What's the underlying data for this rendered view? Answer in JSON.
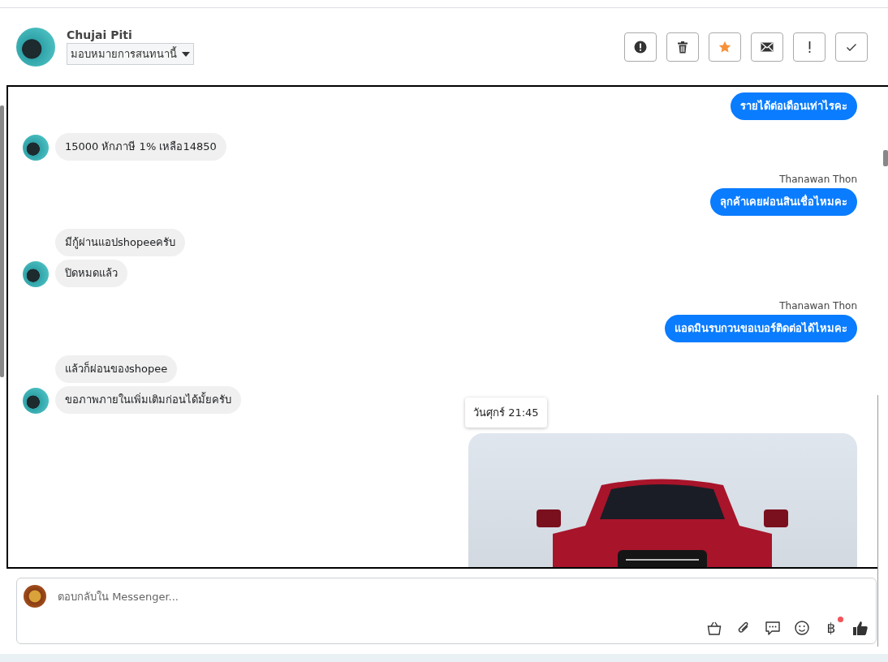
{
  "header": {
    "name": "Chujai Piti",
    "assign": "มอบหมายการสนทนานี้",
    "starred": true
  },
  "messages": [
    {
      "outgoing": true,
      "text": "รายได้ต่อเดือนเท่าไรคะ"
    },
    {
      "outgoing": false,
      "avatar": true,
      "text": "15000 หักภาษี 1% เหลือ14850"
    },
    {
      "outgoing": true,
      "sender": "Thanawan Thon",
      "text": "ลุกค้าเคยผ่อนสินเชื่อไหมคะ"
    },
    {
      "outgoing": false,
      "avatar": false,
      "text": "มีกู้ผ่านแอปshopeeครับ"
    },
    {
      "outgoing": false,
      "avatar": true,
      "text": "ปิดหมดแล้ว"
    },
    {
      "outgoing": true,
      "sender": "Thanawan Thon",
      "text": "แอดมินรบกวนขอเบอร์ติดต่อได้ไหมคะ"
    },
    {
      "outgoing": false,
      "avatar": false,
      "text": "แล้วก็ผ่อนของshopee"
    },
    {
      "outgoing": false,
      "avatar": true,
      "text": "ขอภาพภายในเพิ่มเติมก่อนได้มั้ยครับ"
    },
    {
      "outgoing": true,
      "kind": "image",
      "tooltip": "วันศุกร์ 21:45"
    }
  ],
  "composer": {
    "placeholder": "ตอบกลับใน Messenger...",
    "currency": "฿",
    "currency_badge": true
  }
}
